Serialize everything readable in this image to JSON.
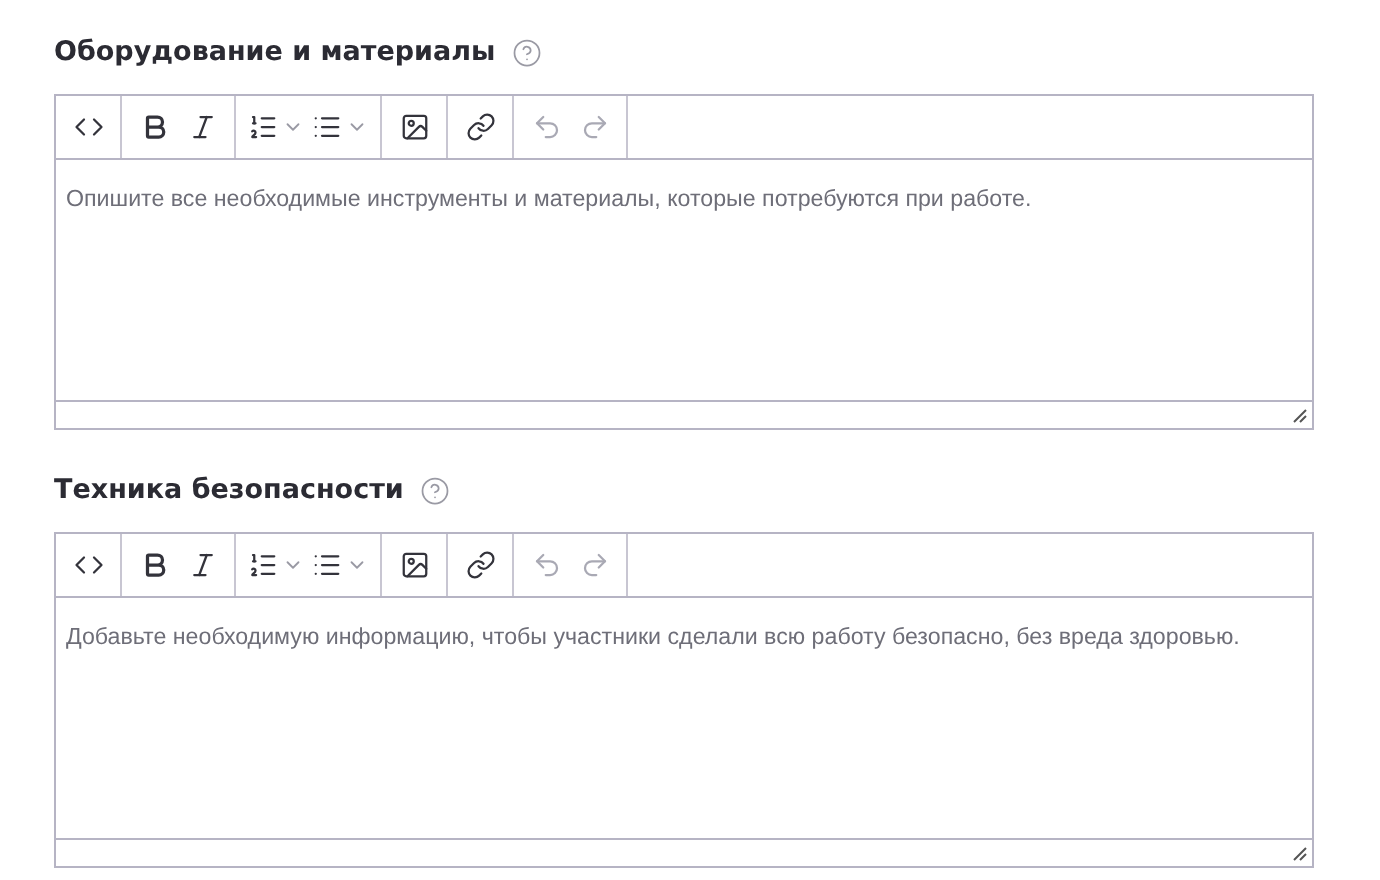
{
  "fields": [
    {
      "label": "Оборудование и материалы",
      "placeholder": "Опишите все необходимые инструменты и материалы, которые потребуются при работе."
    },
    {
      "label": "Техника безопасности",
      "placeholder": "Добавьте необходимую информацию, чтобы участники сделали всю работу безопасно, без вреда здоровью."
    }
  ]
}
